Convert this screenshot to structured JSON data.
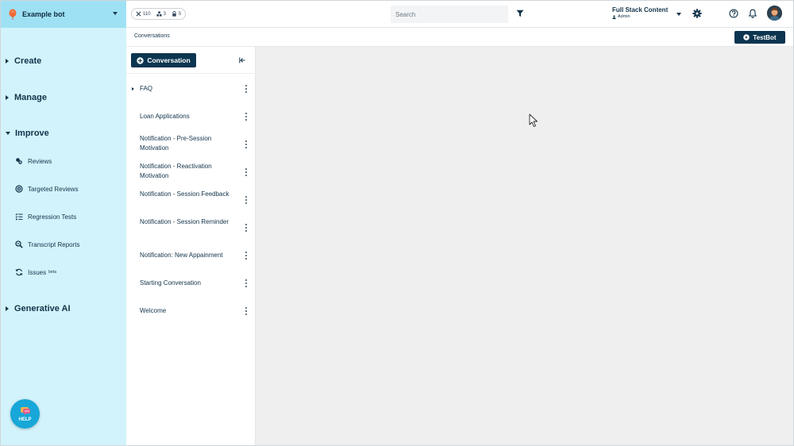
{
  "sidebar": {
    "bot_name": "Example bot",
    "sections": {
      "create": "Create",
      "manage": "Manage",
      "improve": "Improve",
      "generative_ai": "Generative AI"
    },
    "improve_items": {
      "reviews": "Reviews",
      "targeted_reviews": "Targeted Reviews",
      "regression_tests": "Regression Tests",
      "transcript_reports": "Transcript Reports",
      "issues": "Issues",
      "issues_badge": "beta"
    },
    "help_label": "HELP"
  },
  "topbar": {
    "stats": {
      "primary": "110",
      "secondary": "3",
      "locked": "5"
    },
    "search_placeholder": "Search",
    "user_name": "Full Stack Content",
    "user_role": "Admin"
  },
  "subbar": {
    "breadcrumb": "Conversations",
    "testbot_label": "TestBot"
  },
  "conversations": {
    "add_button_label": "Conversation",
    "items": [
      "FAQ",
      "Loan Applications",
      "Notification - Pre-Session Motivation",
      "Notification - Reactivation Motivation",
      "Notification - Session Feedback",
      "Notification - Session Reminder",
      "Notification: New Appainment",
      "Starting Conversation",
      "Welcome"
    ]
  },
  "colors": {
    "sidebar_bg": "#d2f3fb",
    "bot_select_bg": "#9fe1f4",
    "primary_button": "#0b3550",
    "help_button": "#17a7d8",
    "workspace_bg": "#efeff0"
  },
  "icons": {
    "bot_logo": "balloon-icon",
    "filter": "filter-icon",
    "settings": "gear-icon",
    "help": "question-circle-icon",
    "notifications": "bell-icon",
    "collapse": "collapse-left-icon"
  }
}
